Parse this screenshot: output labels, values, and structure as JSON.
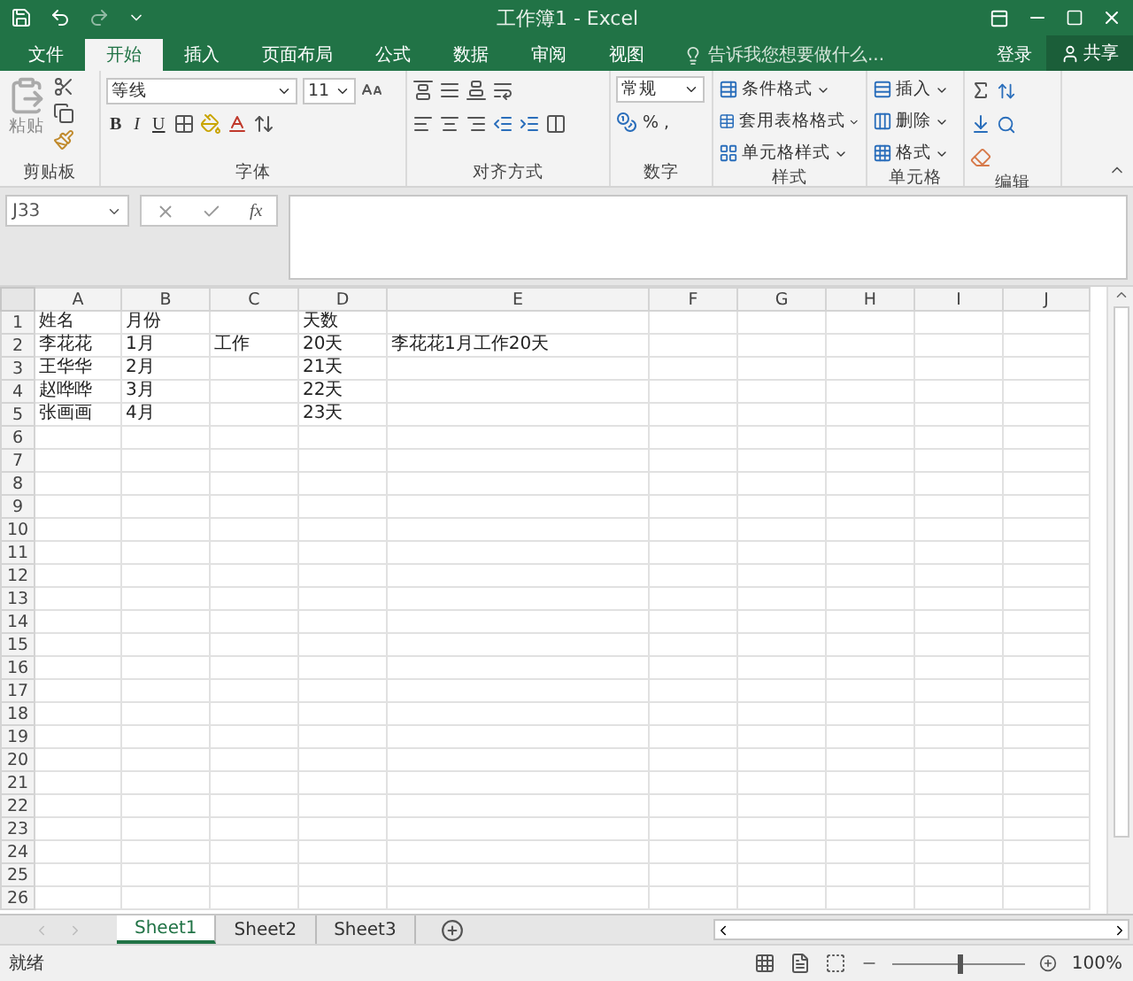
{
  "window": {
    "title": "工作簿1 - Excel"
  },
  "ribbon_tabs": [
    {
      "label": "文件",
      "selected": false
    },
    {
      "label": "开始",
      "selected": true
    },
    {
      "label": "插入",
      "selected": false
    },
    {
      "label": "页面布局",
      "selected": false
    },
    {
      "label": "公式",
      "selected": false
    },
    {
      "label": "数据",
      "selected": false
    },
    {
      "label": "审阅",
      "selected": false
    },
    {
      "label": "视图",
      "selected": false
    }
  ],
  "tell_me": {
    "placeholder": "告诉我您想要做什么..."
  },
  "account": {
    "sign_in": "登录",
    "share": "共享"
  },
  "ribbon": {
    "clipboard": {
      "label": "剪贴板",
      "paste": "粘贴"
    },
    "font": {
      "label": "字体",
      "font_name": "等线",
      "font_size": "11",
      "bold": "B",
      "italic": "I",
      "underline": "U"
    },
    "alignment": {
      "label": "对齐方式"
    },
    "number": {
      "label": "数字",
      "format": "常规",
      "percent": "%",
      "comma": ","
    },
    "styles": {
      "label": "样式",
      "items": [
        "条件格式",
        "套用表格格式",
        "单元格样式"
      ]
    },
    "cells": {
      "label": "单元格",
      "items": [
        "插入",
        "删除",
        "格式"
      ]
    },
    "editing": {
      "label": "编辑"
    }
  },
  "formula_bar": {
    "name_box": "J33",
    "function": "fx"
  },
  "sheet": {
    "columns": [
      "A",
      "B",
      "C",
      "D",
      "E",
      "F",
      "G",
      "H",
      "I",
      "J"
    ],
    "rows": [
      {
        "number": "1",
        "cells": [
          "姓名",
          "月份",
          "",
          "天数",
          "",
          "",
          "",
          "",
          "",
          ""
        ]
      },
      {
        "number": "2",
        "cells": [
          "李花花",
          "1月",
          "工作",
          "20天",
          "李花花1月工作20天",
          "",
          "",
          "",
          "",
          ""
        ]
      },
      {
        "number": "3",
        "cells": [
          "王华华",
          "2月",
          "",
          "21天",
          "",
          "",
          "",
          "",
          "",
          ""
        ]
      },
      {
        "number": "4",
        "cells": [
          "赵哗哗",
          "3月",
          "",
          "22天",
          "",
          "",
          "",
          "",
          "",
          ""
        ]
      },
      {
        "number": "5",
        "cells": [
          "张画画",
          "4月",
          "",
          "23天",
          "",
          "",
          "",
          "",
          "",
          ""
        ]
      },
      {
        "number": "6"
      },
      {
        "number": "7"
      },
      {
        "number": "8"
      },
      {
        "number": "9"
      },
      {
        "number": "10"
      },
      {
        "number": "11"
      },
      {
        "number": "12"
      },
      {
        "number": "13"
      },
      {
        "number": "14"
      },
      {
        "number": "15"
      },
      {
        "number": "16"
      },
      {
        "number": "17"
      },
      {
        "number": "18"
      },
      {
        "number": "19"
      },
      {
        "number": "20"
      },
      {
        "number": "21"
      },
      {
        "number": "22"
      },
      {
        "number": "23"
      },
      {
        "number": "24"
      },
      {
        "number": "25"
      },
      {
        "number": "26"
      }
    ]
  },
  "sheet_tabs": [
    {
      "label": "Sheet1",
      "selected": true
    },
    {
      "label": "Sheet2",
      "selected": false
    },
    {
      "label": "Sheet3",
      "selected": false
    }
  ],
  "status_bar": {
    "status": "就绪",
    "zoom": "100%",
    "zoom_level": {
      "level": 0.5
    }
  }
}
